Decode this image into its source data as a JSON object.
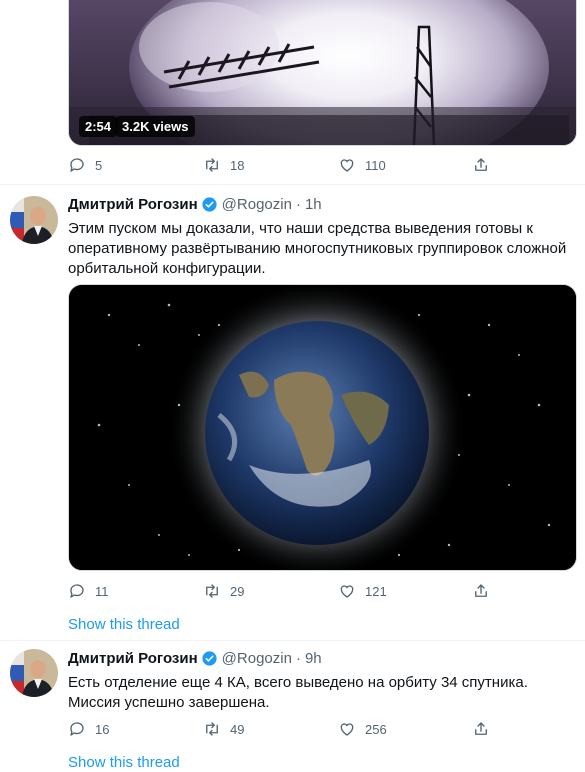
{
  "tweet_video": {
    "duration": "2:54",
    "views": "3.2K views",
    "actions": {
      "replies": "5",
      "retweets": "18",
      "likes": "110"
    }
  },
  "tweet_earth": {
    "author": {
      "name": "Дмитрий Рогозин",
      "handle": "@Rogozin",
      "time": "1h"
    },
    "separator": "·",
    "text": "Этим пуском мы доказали, что наши средства выведения готовы к оперативному развёртыванию многоспутниковых группировок сложной орбитальной конфигурации.",
    "actions": {
      "replies": "11",
      "retweets": "29",
      "likes": "121"
    },
    "show_thread": "Show this thread"
  },
  "tweet_success": {
    "author": {
      "name": "Дмитрий Рогозин",
      "handle": "@Rogozin",
      "time": "9h"
    },
    "separator": "·",
    "text": "Есть отделение еще 4 КА, всего выведено на орбиту 34 спутника. Миссия успешно завершена.",
    "actions": {
      "replies": "16",
      "retweets": "49",
      "likes": "256"
    },
    "show_thread": "Show this thread"
  },
  "icons": {
    "reply": "reply-icon",
    "retweet": "retweet-icon",
    "like": "heart-icon",
    "share": "share-icon",
    "verified": "verified-badge-icon"
  },
  "colors": {
    "link": "#1d9bf0",
    "muted": "#536471",
    "verified": "#1d9bf0"
  }
}
